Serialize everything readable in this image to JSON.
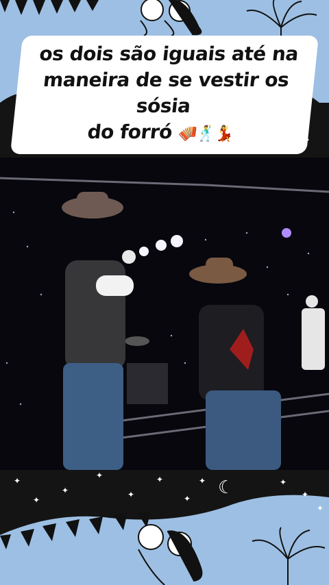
{
  "caption": {
    "line1": "os dois são iguais até na",
    "line2": "maneira de se vestir os sósia",
    "line3": "do forró",
    "emojis": "🪗🕺💃"
  },
  "colors": {
    "background": "#9dbfe3",
    "caption_bg": "#ffffff",
    "video_bg": "#0b0b14",
    "band_dark": "#141414"
  },
  "icons": [
    "festa-junina-couple-illustration",
    "fireworks-illustration",
    "bunting-flags",
    "moon-icon",
    "star-icon",
    "accordion-emoji",
    "man-dancing-emoji",
    "woman-dancing-emoji"
  ]
}
